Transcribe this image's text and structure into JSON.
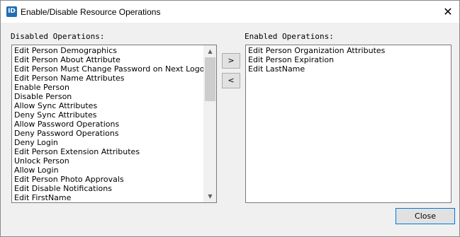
{
  "window": {
    "title": "Enable/Disable Resource Operations",
    "app_icon_text": "ID",
    "close_glyph": "✕"
  },
  "disabled": {
    "label": "Disabled Operations:",
    "items": [
      "Edit Person Demographics",
      "Edit Person About Attribute",
      "Edit Person Must Change Password on Next Logon",
      "Edit Person Name Attributes",
      "Enable Person",
      "Disable Person",
      "Allow Sync Attributes",
      "Deny Sync Attributes",
      "Allow Password Operations",
      "Deny Password Operations",
      "Deny Login",
      "Edit Person Extension Attributes",
      "Unlock Person",
      "Allow Login",
      "Edit Person Photo Approvals",
      "Edit Disable Notifications",
      "Edit FirstName"
    ]
  },
  "enabled": {
    "label": "Enabled Operations:",
    "items": [
      "Edit Person Organization Attributes",
      "Edit Person Expiration",
      "Edit LastName"
    ]
  },
  "buttons": {
    "move_right": ">",
    "move_left": "<",
    "close": "Close"
  },
  "scrollbar": {
    "up_glyph": "▲",
    "down_glyph": "▼"
  }
}
